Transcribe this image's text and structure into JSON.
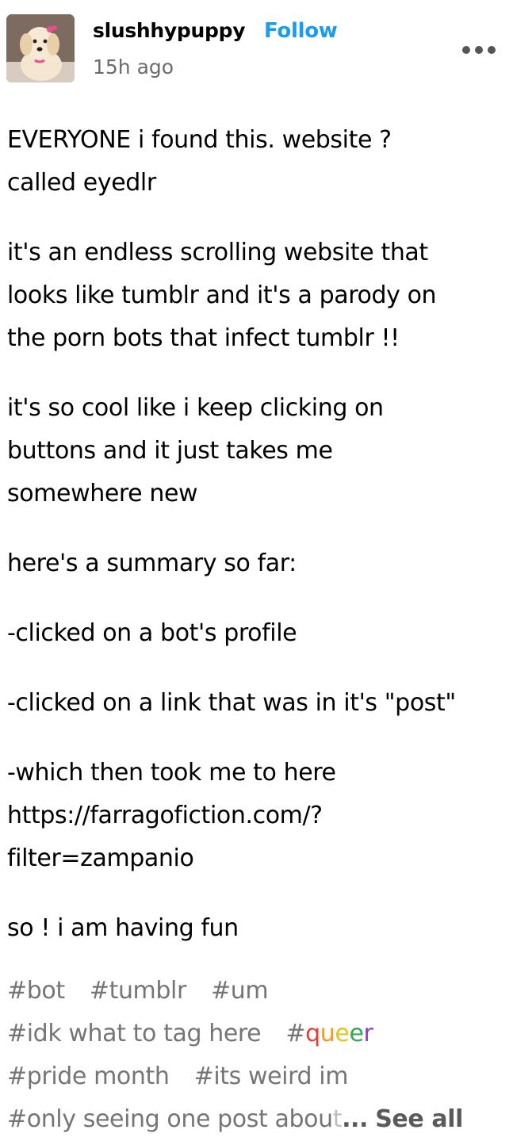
{
  "post": {
    "author": {
      "username": "slushhypuppy",
      "follow_label": "Follow",
      "timestamp": "15h ago",
      "avatar_icon": "puppy-avatar"
    },
    "menu_icon": "more-options-icon",
    "paragraphs": [
      [
        "EVERYONE i found this. website ?",
        "called eyedlr"
      ],
      [
        "it's an endless scrolling website that",
        "looks like tumblr and it's a parody on",
        "the porn bots that infect tumblr !!"
      ],
      [
        "it's so cool like i keep clicking on",
        "buttons and it just takes me",
        "somewhere new"
      ],
      [
        "here's a summary so far:"
      ],
      [
        "-clicked on a bot's profile"
      ],
      [
        "-clicked on a link that was in it's \"post\""
      ],
      [
        "-which then took me to here",
        "https://farragofiction.com/?",
        "filter=zampanio"
      ],
      [
        "so !  i am having fun"
      ]
    ],
    "tags": {
      "row1": [
        "#bot",
        "#tumblr",
        "#um"
      ],
      "row2_tag": "#idk what to tag here",
      "queer_hash": "#",
      "queer_letters": [
        "q",
        "u",
        "e",
        "e",
        "r"
      ],
      "row3": [
        "#pride month",
        "#its weird  im"
      ],
      "row4_visible": "#only seeing one post abou",
      "row4_faded": "t",
      "ellipsis": "...",
      "see_all_label": "See all"
    },
    "colors": {
      "follow": "#1a9cf0",
      "tag_text": "#757575",
      "timestamp": "#6b6b6b"
    }
  }
}
